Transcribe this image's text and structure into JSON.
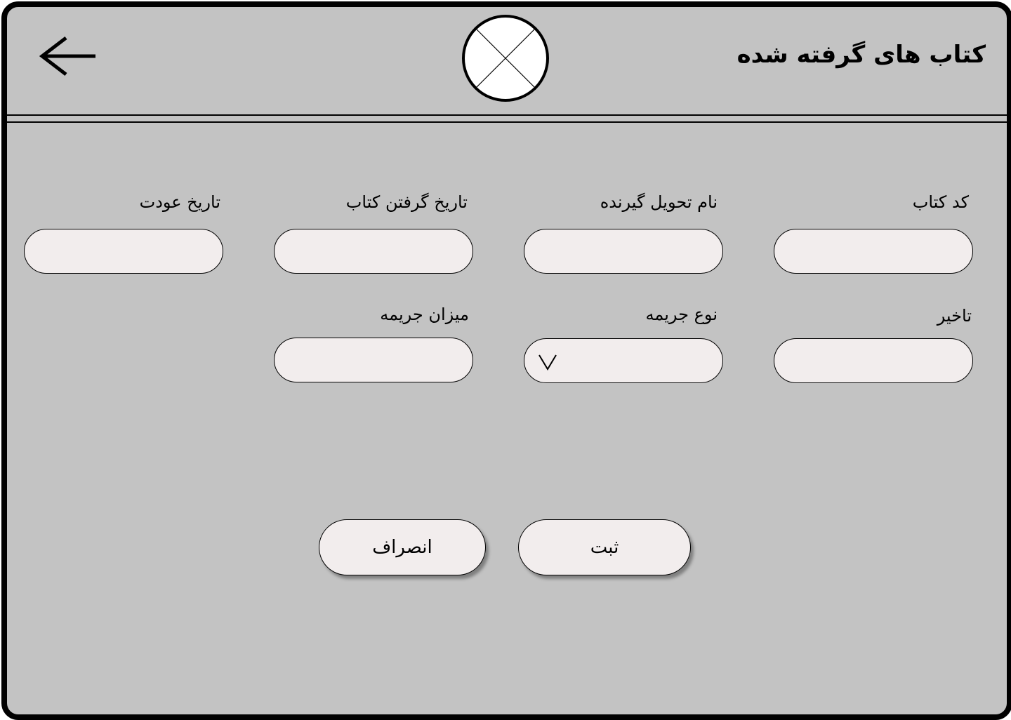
{
  "header": {
    "title": "کتاب های گرفته شده",
    "back_icon": "arrow-left-icon",
    "logo_icon": "image-placeholder-icon"
  },
  "form": {
    "book_code": {
      "label": "کد کتاب",
      "value": ""
    },
    "receiver_name": {
      "label": "نام تحویل گیرنده",
      "value": ""
    },
    "borrow_date": {
      "label": "تاریخ گرفتن کتاب",
      "value": ""
    },
    "return_date": {
      "label": "تاریخ عودت",
      "value": ""
    },
    "delay": {
      "label": "تاخیر",
      "value": ""
    },
    "fine_type": {
      "label": "نوع جریمه",
      "value": "",
      "icon": "chevron-down-icon"
    },
    "fine_amount": {
      "label": "میزان جریمه",
      "value": ""
    }
  },
  "actions": {
    "submit_label": "ثبت",
    "cancel_label": "انصراف"
  },
  "colors": {
    "background": "#c3c3c3",
    "input_fill": "#f2eded",
    "border": "#000000"
  }
}
